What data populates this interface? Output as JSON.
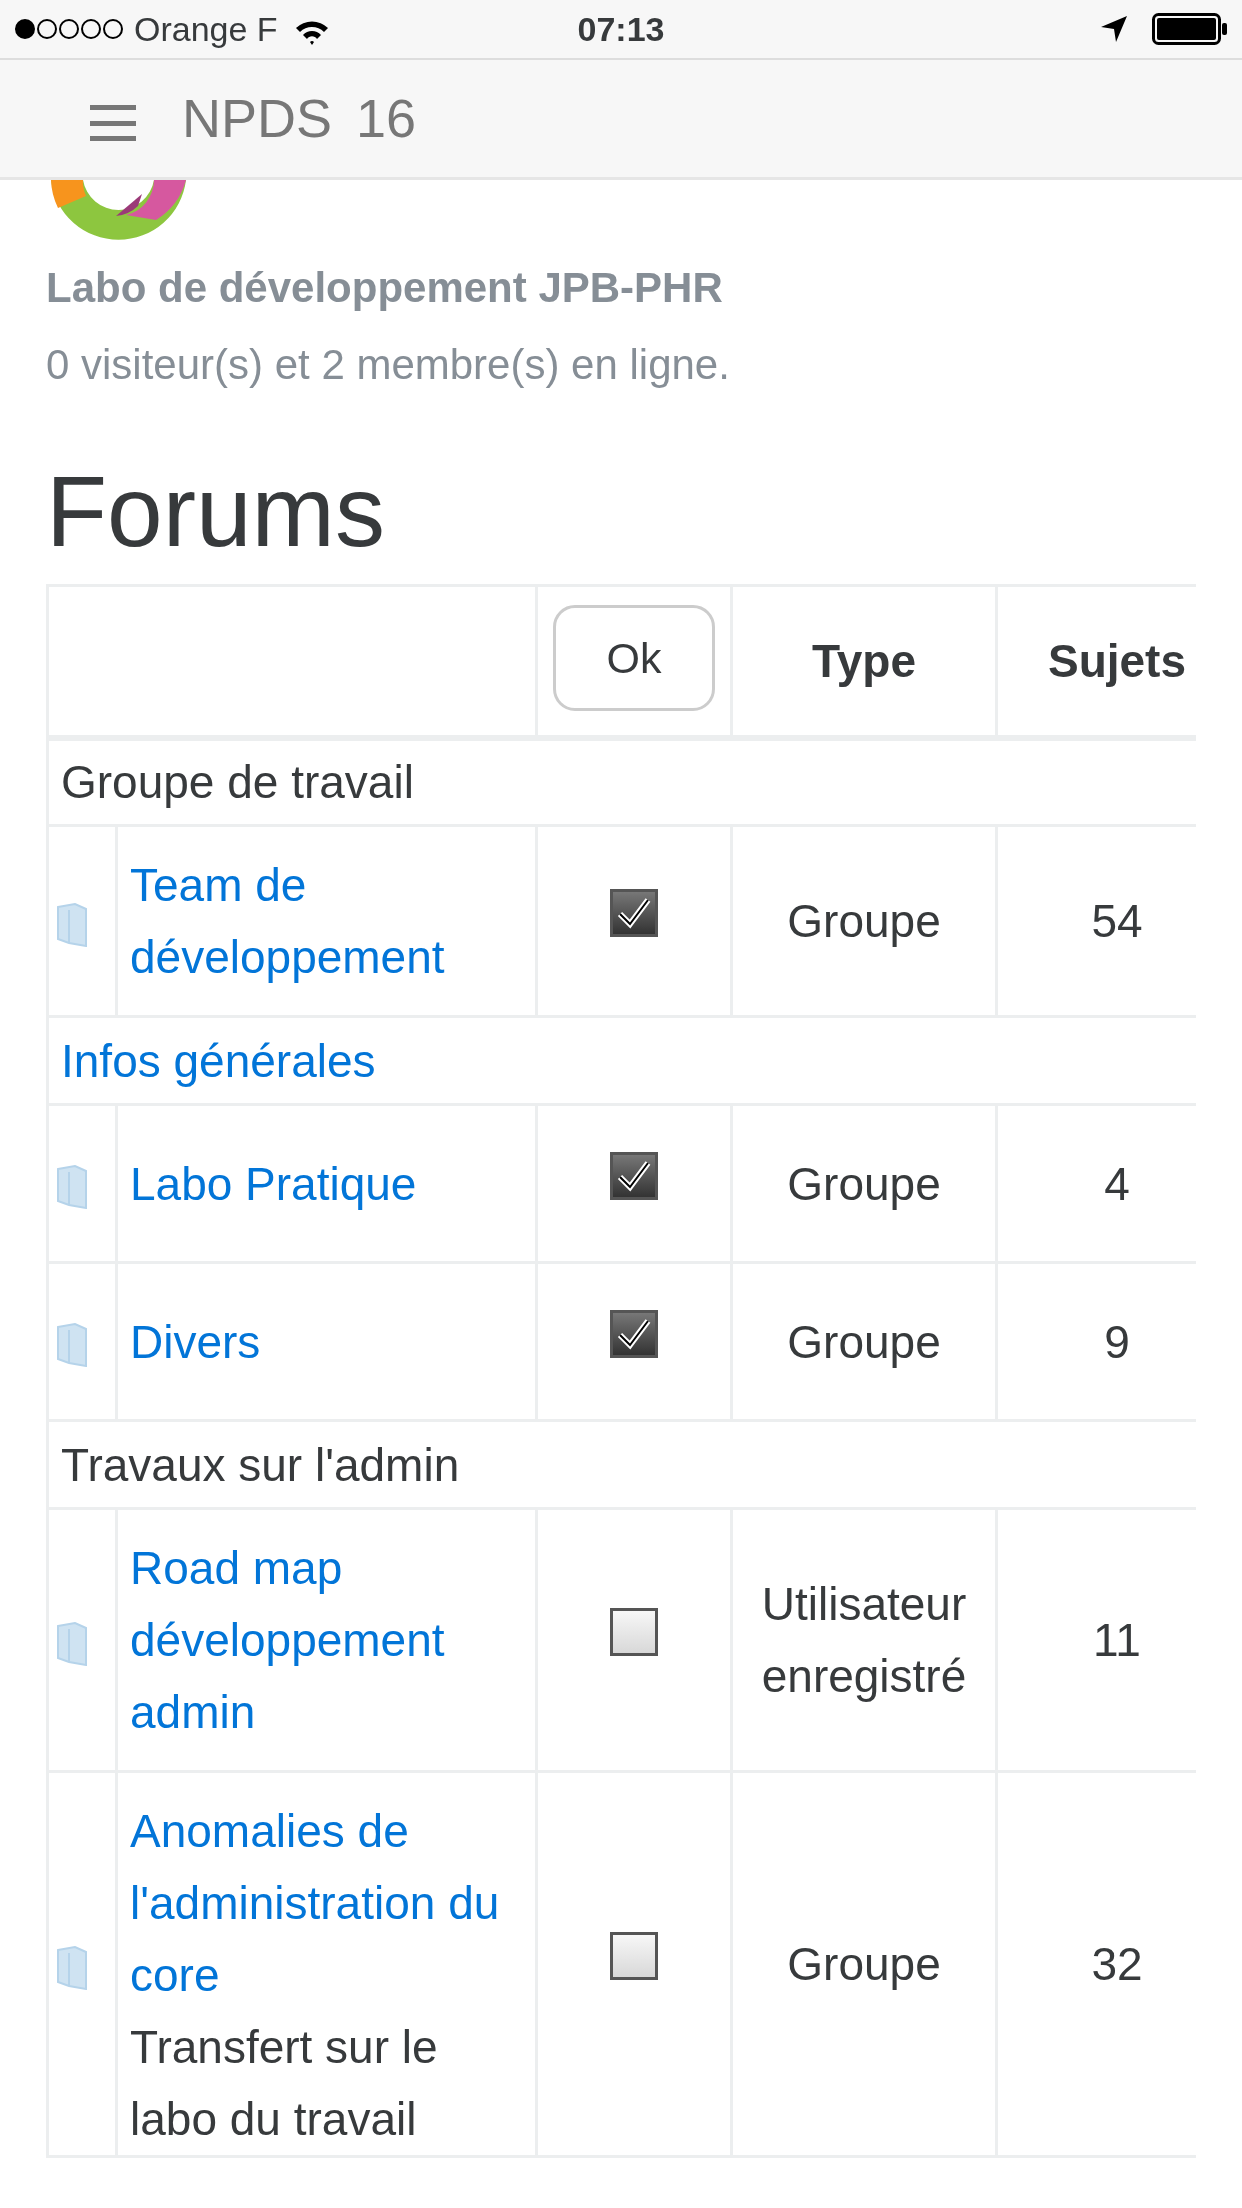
{
  "status_bar": {
    "carrier": "Orange F",
    "time": "07:13"
  },
  "navbar": {
    "brand": "NPDS",
    "version": "16"
  },
  "site": {
    "name": "Labo de développement JPB-PHR",
    "online": "0 visiteur(s) et 2 membre(s) en ligne."
  },
  "heading": "Forums",
  "table": {
    "ok_button": "Ok",
    "columns": [
      "Type",
      "Sujets"
    ],
    "rows": [
      {
        "kind": "category",
        "title": "Groupe de travail",
        "link": false
      },
      {
        "kind": "forum",
        "title": "Team de développement",
        "checked": true,
        "type": "Groupe",
        "topics": "54"
      },
      {
        "kind": "category",
        "title": "Infos générales",
        "link": true
      },
      {
        "kind": "forum",
        "title": "Labo Pratique",
        "checked": true,
        "type": "Groupe",
        "topics": "4"
      },
      {
        "kind": "forum",
        "title": "Divers",
        "checked": true,
        "type": "Groupe",
        "topics": "9"
      },
      {
        "kind": "category",
        "title": "Travaux sur l'admin",
        "link": false
      },
      {
        "kind": "forum",
        "title": "Road map développement admin",
        "checked": false,
        "type": "Utilisateur enregistré",
        "topics": "11"
      },
      {
        "kind": "forum",
        "title": "Anomalies de l'administration du core",
        "description": "Transfert sur le labo du travail",
        "checked": false,
        "type": "Groupe",
        "topics": "32"
      }
    ]
  }
}
